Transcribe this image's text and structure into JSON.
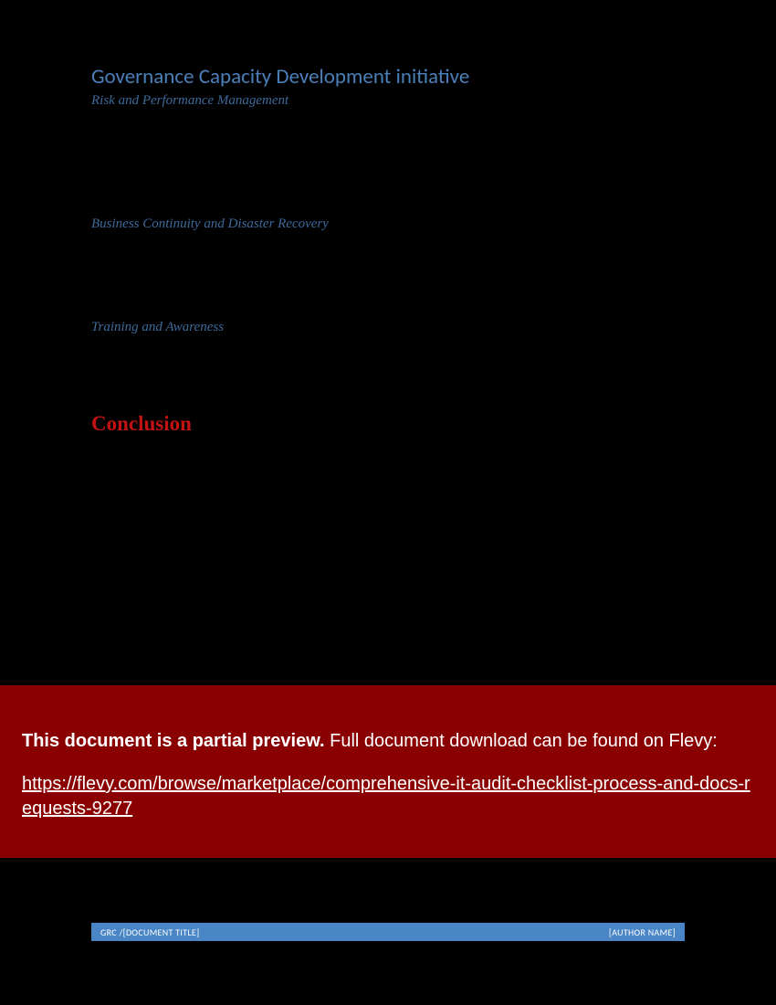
{
  "document": {
    "main_title": "Governance Capacity Development initiative",
    "sections": {
      "s1": "Risk and Performance Management",
      "s2": "Business Continuity and Disaster Recovery",
      "s3": "Training and Awareness"
    },
    "conclusion_heading": "Conclusion"
  },
  "banner": {
    "bold_text": "This document is a partial preview.",
    "rest_text": "  Full document download can be found on Flevy:",
    "link_text": "https://flevy.com/browse/marketplace/comprehensive-it-audit-checklist-process-and-docs-requests-9277"
  },
  "footer": {
    "left": "GRC /[DOCUMENT TITLE]",
    "right": "[AUTHOR NAME]"
  }
}
